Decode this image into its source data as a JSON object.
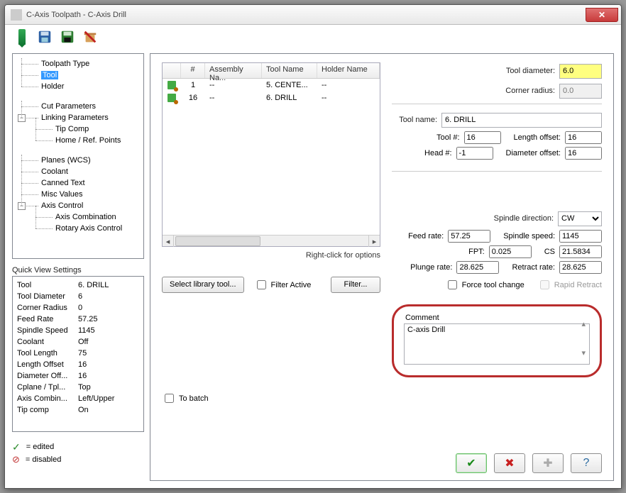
{
  "window": {
    "title": "C-Axis Toolpath - C-Axis Drill"
  },
  "tree": {
    "items": [
      "Toolpath Type",
      "Tool",
      "Holder",
      "Cut Parameters",
      "Linking Parameters",
      "Tip Comp",
      "Home / Ref. Points",
      "Planes (WCS)",
      "Coolant",
      "Canned Text",
      "Misc Values",
      "Axis Control",
      "Axis Combination",
      "Rotary Axis Control"
    ]
  },
  "quick_view": {
    "title": "Quick View Settings",
    "rows": [
      {
        "k": "Tool",
        "v": "6. DRILL"
      },
      {
        "k": "Tool Diameter",
        "v": "6"
      },
      {
        "k": "Corner Radius",
        "v": "0"
      },
      {
        "k": "Feed Rate",
        "v": "57.25"
      },
      {
        "k": "Spindle Speed",
        "v": "1145"
      },
      {
        "k": "Coolant",
        "v": "Off"
      },
      {
        "k": "Tool Length",
        "v": "75"
      },
      {
        "k": "Length Offset",
        "v": "16"
      },
      {
        "k": "Diameter Off...",
        "v": "16"
      },
      {
        "k": "Cplane / Tpl...",
        "v": "Top"
      },
      {
        "k": "Axis Combin...",
        "v": "Left/Upper"
      },
      {
        "k": "Tip comp",
        "v": "On"
      }
    ]
  },
  "legend": {
    "edited": "= edited",
    "disabled": "= disabled"
  },
  "grid": {
    "headers": {
      "num": "#",
      "asm": "Assembly Na...",
      "tool": "Tool Name",
      "holder": "Holder Name"
    },
    "rows": [
      {
        "num": "1",
        "asm": "--",
        "tool": "5. CENTE...",
        "holder": "--"
      },
      {
        "num": "16",
        "asm": "--",
        "tool": "6. DRILL",
        "holder": "--"
      }
    ],
    "hint": "Right-click for options"
  },
  "buttons": {
    "select_lib": "Select library tool...",
    "filter_active": "Filter Active",
    "filter": "Filter..."
  },
  "params": {
    "tool_diameter": {
      "label": "Tool diameter:",
      "value": "6.0"
    },
    "corner_radius": {
      "label": "Corner radius:",
      "value": "0.0"
    },
    "tool_name": {
      "label": "Tool name:",
      "value": "6. DRILL"
    },
    "tool_num": {
      "label": "Tool #:",
      "value": "16"
    },
    "length_offset": {
      "label": "Length offset:",
      "value": "16"
    },
    "head_num": {
      "label": "Head #:",
      "value": "-1"
    },
    "diameter_offset": {
      "label": "Diameter offset:",
      "value": "16"
    },
    "spindle_dir": {
      "label": "Spindle direction:",
      "value": "CW"
    },
    "feed_rate": {
      "label": "Feed rate:",
      "value": "57.25"
    },
    "spindle_speed": {
      "label": "Spindle speed:",
      "value": "1145"
    },
    "fpt": {
      "label": "FPT:",
      "value": "0.025"
    },
    "cs": {
      "label": "CS",
      "value": "21.5834"
    },
    "plunge_rate": {
      "label": "Plunge rate:",
      "value": "28.625"
    },
    "retract_rate": {
      "label": "Retract rate:",
      "value": "28.625"
    },
    "force_tool_change": "Force tool change",
    "rapid_retract": "Rapid Retract"
  },
  "comment": {
    "label": "Comment",
    "text": "C-axis Drill"
  },
  "batch": {
    "label": "To batch"
  }
}
